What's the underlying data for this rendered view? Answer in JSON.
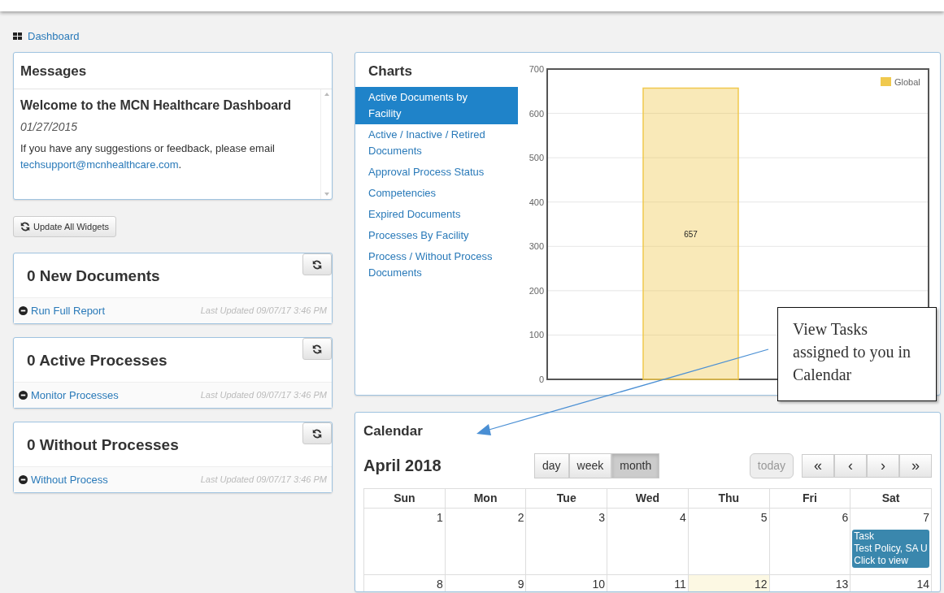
{
  "breadcrumb": {
    "label": "Dashboard"
  },
  "messages": {
    "title": "Messages",
    "heading": "Welcome to the MCN Healthcare Dashboard",
    "date": "01/27/2015",
    "text": "If you have any suggestions or feedback, please email",
    "email": "techsupport@mcnhealthcare.com",
    "after_email": "."
  },
  "update_button": {
    "label": "Update All Widgets"
  },
  "widgets": [
    {
      "title": "0 New Documents",
      "link": "Run Full Report",
      "updated": "Last Updated 09/07/17 3:46 PM"
    },
    {
      "title": "0 Active Processes",
      "link": "Monitor Processes",
      "updated": "Last Updated 09/07/17 3:46 PM"
    },
    {
      "title": "0 Without Processes",
      "link": "Without Process",
      "updated": "Last Updated 09/07/17 3:46 PM"
    }
  ],
  "charts": {
    "title": "Charts",
    "items": [
      {
        "label": "Active Documents by Facility",
        "selected": true
      },
      {
        "label": "Active / Inactive / Retired Documents",
        "selected": false
      },
      {
        "label": "Approval Process Status",
        "selected": false
      },
      {
        "label": "Competencies",
        "selected": false
      },
      {
        "label": "Expired Documents",
        "selected": false
      },
      {
        "label": "Processes By Facility",
        "selected": false
      },
      {
        "label": "Process / Without Process Documents",
        "selected": false
      }
    ],
    "chart_data": {
      "type": "bar",
      "series": [
        {
          "name": "Global",
          "color": "#f0c94e",
          "values": [
            657
          ]
        }
      ],
      "ylim": [
        0,
        700
      ],
      "yticks": [
        0,
        100,
        200,
        300,
        400,
        500,
        600,
        700
      ],
      "grid": true,
      "data_labels": true
    }
  },
  "calendar": {
    "title": "Calendar",
    "month": "April 2018",
    "views": [
      {
        "label": "day",
        "selected": false
      },
      {
        "label": "week",
        "selected": false
      },
      {
        "label": "month",
        "selected": true
      }
    ],
    "today_button": {
      "label": "today",
      "disabled": true
    },
    "nav_buttons": [
      "«",
      "‹",
      "›",
      "»"
    ],
    "weekdays": [
      "Sun",
      "Mon",
      "Tue",
      "Wed",
      "Thu",
      "Fri",
      "Sat"
    ],
    "weeks": [
      [
        {
          "day": "1",
          "today": false
        },
        {
          "day": "2",
          "today": false
        },
        {
          "day": "3",
          "today": false
        },
        {
          "day": "4",
          "today": false
        },
        {
          "day": "5",
          "today": false
        },
        {
          "day": "6",
          "today": false
        },
        {
          "day": "7",
          "today": false,
          "events": [
            {
              "kind": "task",
              "lines": [
                "Task",
                "Test Policy, SA U",
                "Click to view"
              ]
            }
          ]
        }
      ],
      [
        {
          "day": "8",
          "today": false
        },
        {
          "day": "9",
          "today": false
        },
        {
          "day": "10",
          "today": false
        },
        {
          "day": "11",
          "today": false
        },
        {
          "day": "12",
          "today": true
        },
        {
          "day": "13",
          "today": false
        },
        {
          "day": "14",
          "today": false
        }
      ]
    ]
  },
  "callout": {
    "text": "View Tasks assigned to you in Calendar"
  }
}
